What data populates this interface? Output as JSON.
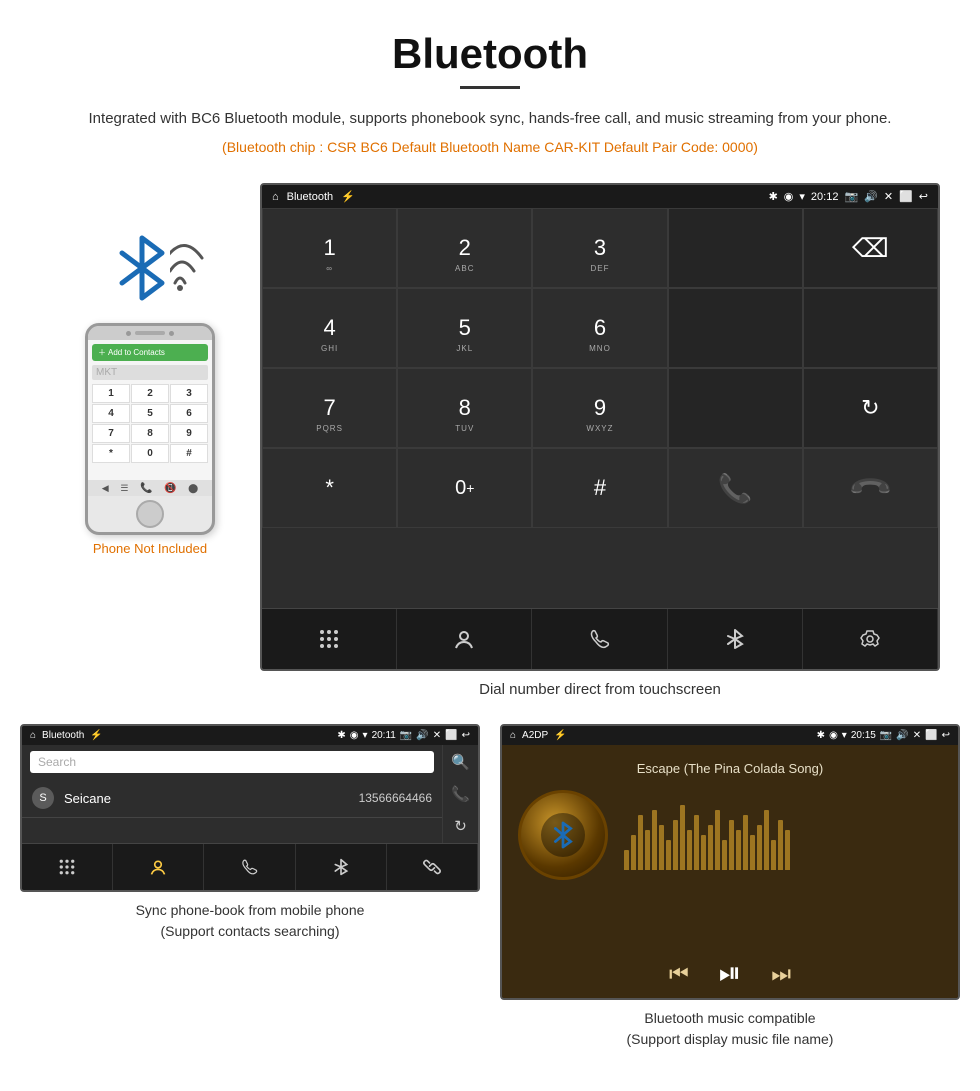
{
  "header": {
    "title": "Bluetooth",
    "description": "Integrated with BC6 Bluetooth module, supports phonebook sync, hands-free call, and music streaming from your phone.",
    "specs": "(Bluetooth chip : CSR BC6    Default Bluetooth Name CAR-KIT    Default Pair Code: 0000)"
  },
  "dialer": {
    "status_bar": {
      "app_name": "Bluetooth",
      "time": "20:12"
    },
    "keys": [
      {
        "num": "1",
        "sub": "∞",
        "col": 1,
        "row": 1
      },
      {
        "num": "2",
        "sub": "ABC",
        "col": 2,
        "row": 1
      },
      {
        "num": "3",
        "sub": "DEF",
        "col": 3,
        "row": 1
      },
      {
        "num": "4",
        "sub": "GHI",
        "col": 1,
        "row": 2
      },
      {
        "num": "5",
        "sub": "JKL",
        "col": 2,
        "row": 2
      },
      {
        "num": "6",
        "sub": "MNO",
        "col": 3,
        "row": 2
      },
      {
        "num": "7",
        "sub": "PQRS",
        "col": 1,
        "row": 3
      },
      {
        "num": "8",
        "sub": "TUV",
        "col": 2,
        "row": 3
      },
      {
        "num": "9",
        "sub": "WXYZ",
        "col": 3,
        "row": 3
      },
      {
        "num": "*",
        "sub": "",
        "col": 1,
        "row": 4
      },
      {
        "num": "0",
        "sub": "+",
        "col": 2,
        "row": 4
      },
      {
        "num": "#",
        "sub": "",
        "col": 3,
        "row": 4
      }
    ],
    "caption": "Dial number direct from touchscreen"
  },
  "phone": {
    "not_included_label": "Phone Not Included",
    "keys": [
      "1",
      "2",
      "3",
      "4",
      "5",
      "6",
      "7",
      "8",
      "9",
      "*",
      "0",
      "#"
    ]
  },
  "phonebook": {
    "status_time": "20:11",
    "app_name": "Bluetooth",
    "search_placeholder": "Search",
    "contact_name": "Seicane",
    "contact_number": "13566664466",
    "caption_line1": "Sync phone-book from mobile phone",
    "caption_line2": "(Support contacts searching)"
  },
  "music": {
    "status_time": "20:15",
    "app_name": "A2DP",
    "song_title": "Escape (The Pina Colada Song)",
    "caption_line1": "Bluetooth music compatible",
    "caption_line2": "(Support display music file name)",
    "eq_heights": [
      20,
      35,
      55,
      40,
      60,
      45,
      30,
      50,
      65,
      40,
      55,
      35,
      45,
      60,
      30,
      50,
      40,
      55,
      35,
      45,
      60,
      30,
      50,
      40
    ]
  }
}
